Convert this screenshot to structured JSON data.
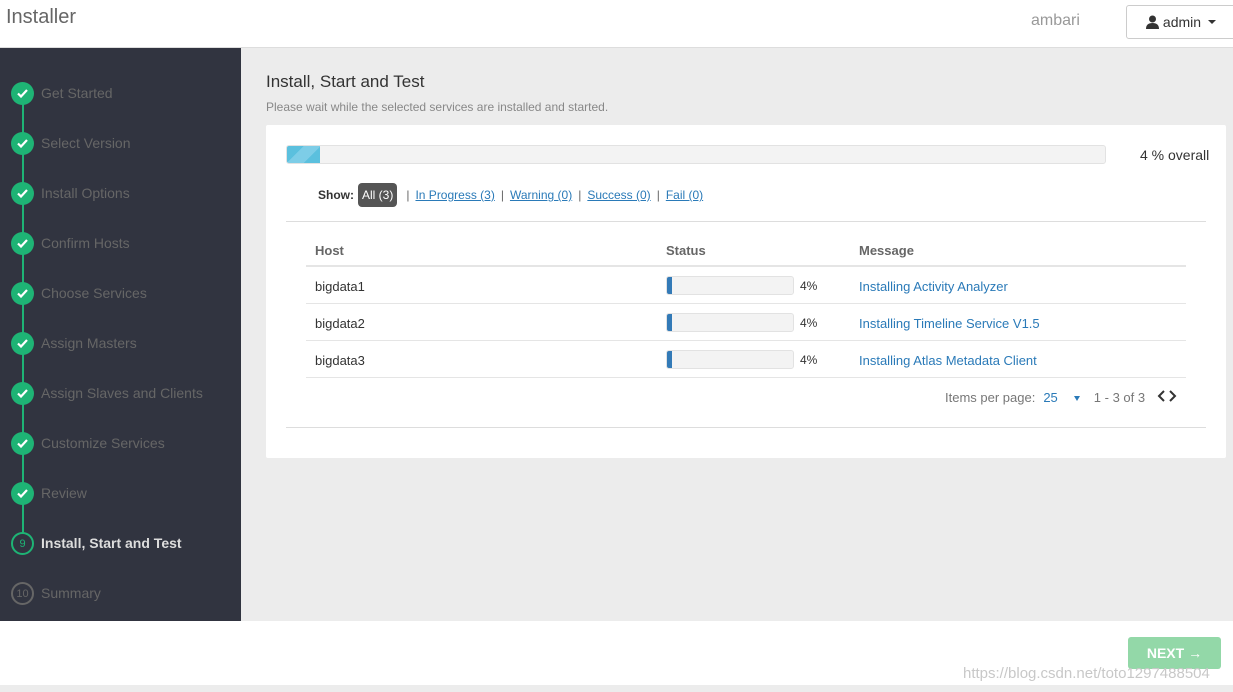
{
  "header": {
    "app_title": "Installer",
    "cluster_name": "ambari",
    "user_label": "admin",
    "user_icon": "user-icon"
  },
  "sidebar": {
    "steps": [
      {
        "label": "Get Started",
        "state": "done"
      },
      {
        "label": "Select Version",
        "state": "done"
      },
      {
        "label": "Install Options",
        "state": "done"
      },
      {
        "label": "Confirm Hosts",
        "state": "done"
      },
      {
        "label": "Choose Services",
        "state": "done"
      },
      {
        "label": "Assign Masters",
        "state": "done"
      },
      {
        "label": "Assign Slaves and Clients",
        "state": "done"
      },
      {
        "label": "Customize Services",
        "state": "done"
      },
      {
        "label": "Review",
        "state": "done"
      },
      {
        "label": "Install, Start and Test",
        "state": "current",
        "number": "9"
      },
      {
        "label": "Summary",
        "state": "todo",
        "number": "10"
      }
    ],
    "colors": {
      "done": "#1eb475",
      "bg": "#313440"
    }
  },
  "main": {
    "title": "Install, Start and Test",
    "subtitle": "Please wait while the selected services are installed and started.",
    "overall": {
      "percent": 4,
      "text": "4 % overall"
    },
    "filters": {
      "show_label": "Show:",
      "all": "All (3)",
      "in_progress": "In Progress (3)",
      "warning": "Warning (0)",
      "success": "Success (0)",
      "fail": "Fail (0)",
      "separator": "|"
    },
    "table": {
      "headers": {
        "host": "Host",
        "status": "Status",
        "message": "Message"
      },
      "rows": [
        {
          "host": "bigdata1",
          "percent": 4,
          "percent_text": "4%",
          "message": "Installing Activity Analyzer"
        },
        {
          "host": "bigdata2",
          "percent": 4,
          "percent_text": "4%",
          "message": "Installing Timeline Service V1.5"
        },
        {
          "host": "bigdata3",
          "percent": 4,
          "percent_text": "4%",
          "message": "Installing Atlas Metadata Client"
        }
      ]
    },
    "pager": {
      "items_per_page_label": "Items per page:",
      "per_page_value": "25",
      "range": "1 - 3 of 3"
    }
  },
  "footer": {
    "next_label": "NEXT",
    "next_arrow": "→",
    "watermark": "https://blog.csdn.net/toto1297488504"
  }
}
